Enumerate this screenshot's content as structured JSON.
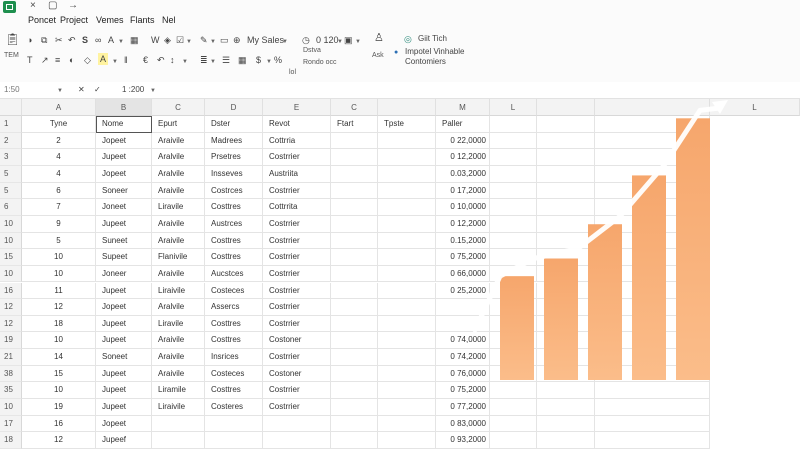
{
  "menu": [
    "Poncet",
    "Project",
    "Vemes",
    "Flants",
    "Nel"
  ],
  "ribbon": {
    "clipboard_label": "TEM",
    "font_size": "0 120",
    "style_select": "My Sales",
    "group_label_1": "Dstva",
    "group_label_2": "Rondo occ",
    "ask_label": "Ask",
    "extra_icon_label": "lol",
    "addin_title": "Giit Tich",
    "addin_line1": "Impotel Vinhable",
    "addin_line2": "Contomiers"
  },
  "formula": {
    "cell_ref": "1:50",
    "value": "1 :200"
  },
  "columns": [
    "A",
    "B",
    "C",
    "D",
    "E",
    "C",
    "",
    "M",
    "L",
    "",
    "",
    "L",
    ""
  ],
  "rows": [
    {
      "n": "1",
      "a": "Tyne",
      "b": "Nome",
      "c": "Epurt",
      "d": "Dster",
      "e": "Revot",
      "f": "Ftart",
      "g": "Tpste",
      "h": "Paller"
    },
    {
      "n": "2",
      "a": "2",
      "b": "Jopeet",
      "c": "Araivile",
      "d": "Madrees",
      "e": "Cottrria",
      "f": "",
      "g": "",
      "h": "0 22,0000"
    },
    {
      "n": "3",
      "a": "4",
      "b": "Jupeet",
      "c": "Aralvile",
      "d": "Prsetres",
      "e": "Costrrier",
      "f": "",
      "g": "",
      "h": "0 12,2000"
    },
    {
      "n": "5",
      "a": "4",
      "b": "Jopeet",
      "c": "Aralvile",
      "d": "Insseves",
      "e": "Austriita",
      "f": "",
      "g": "",
      "h": "0.03,2000"
    },
    {
      "n": "5",
      "a": "6",
      "b": "Soneer",
      "c": "Araivile",
      "d": "Costrces",
      "e": "Costrrier",
      "f": "",
      "g": "",
      "h": "0 17,2000"
    },
    {
      "n": "6",
      "a": "7",
      "b": "Joneet",
      "c": "Liravile",
      "d": "Costtres",
      "e": "Cottrrita",
      "f": "",
      "g": "",
      "h": "0 10,0000"
    },
    {
      "n": "10",
      "a": "9",
      "b": "Jupeet",
      "c": "Araivile",
      "d": "Austrces",
      "e": "Costrrier",
      "f": "",
      "g": "",
      "h": "0 12,2000"
    },
    {
      "n": "10",
      "a": "5",
      "b": "Suneet",
      "c": "Araivile",
      "d": "Costtres",
      "e": "Costrrier",
      "f": "",
      "g": "",
      "h": "0.15,2000"
    },
    {
      "n": "15",
      "a": "10",
      "b": "Supeet",
      "c": "Flanivile",
      "d": "Costtres",
      "e": "Costrrier",
      "f": "",
      "g": "",
      "h": "0 75,2000"
    },
    {
      "n": "10",
      "a": "10",
      "b": "Joneer",
      "c": "Araivile",
      "d": "Aucstces",
      "e": "Costrrier",
      "f": "",
      "g": "",
      "h": "0 66,0000"
    },
    {
      "n": "16",
      "a": "11",
      "b": "Jupeet",
      "c": "Liraivile",
      "d": "Costeces",
      "e": "Costrrier",
      "f": "",
      "g": "",
      "h": "0 25,2000"
    },
    {
      "n": "12",
      "a": "12",
      "b": "Jopeet",
      "c": "Aralvile",
      "d": "Assercs",
      "e": "Costrrier",
      "f": "",
      "g": "",
      "h": ""
    },
    {
      "n": "12",
      "a": "18",
      "b": "Jupeet",
      "c": "Liravile",
      "d": "Costtres",
      "e": "Costrrier",
      "f": "",
      "g": "",
      "h": ""
    },
    {
      "n": "19",
      "a": "10",
      "b": "Jupeet",
      "c": "Araivile",
      "d": "Costtres",
      "e": "Costoner",
      "f": "",
      "g": "",
      "h": "0 74,0000"
    },
    {
      "n": "21",
      "a": "14",
      "b": "Soneet",
      "c": "Araivile",
      "d": "Insrices",
      "e": "Costrrier",
      "f": "",
      "g": "",
      "h": "0 74,2000"
    },
    {
      "n": "38",
      "a": "15",
      "b": "Jupeet",
      "c": "Araivile",
      "d": "Costeces",
      "e": "Costoner",
      "f": "",
      "g": "",
      "h": "0 76,0000"
    },
    {
      "n": "35",
      "a": "10",
      "b": "Jupeet",
      "c": "Liramile",
      "d": "Costtres",
      "e": "Costrrier",
      "f": "",
      "g": "",
      "h": "0 75,2000"
    },
    {
      "n": "10",
      "a": "19",
      "b": "Jupeet",
      "c": "Liraivile",
      "d": "Costeres",
      "e": "Costrrier",
      "f": "",
      "g": "",
      "h": "0 77,2000"
    },
    {
      "n": "17",
      "a": "16",
      "b": "Jopeet",
      "c": "",
      "d": "",
      "e": "",
      "f": "",
      "g": "",
      "h": "0 83,0000"
    },
    {
      "n": "18",
      "a": "12",
      "b": "Jupeef",
      "c": "",
      "d": "",
      "e": "",
      "f": "",
      "g": "",
      "h": "0 93,2000"
    }
  ],
  "chart_data": {
    "type": "bar",
    "title": "",
    "xlabel": "",
    "ylabel": "",
    "categories": [
      "",
      "",
      "",
      "",
      ""
    ],
    "values": [
      100,
      117,
      150,
      197,
      252
    ],
    "ylim": [
      0,
      260
    ],
    "bar_color": "#f6a66c",
    "trend_color": "#ffffff",
    "grid": false,
    "trend_line": true
  },
  "colors": {
    "app_green": "#1e8f4e",
    "bar_orange": "#f6a66c"
  }
}
